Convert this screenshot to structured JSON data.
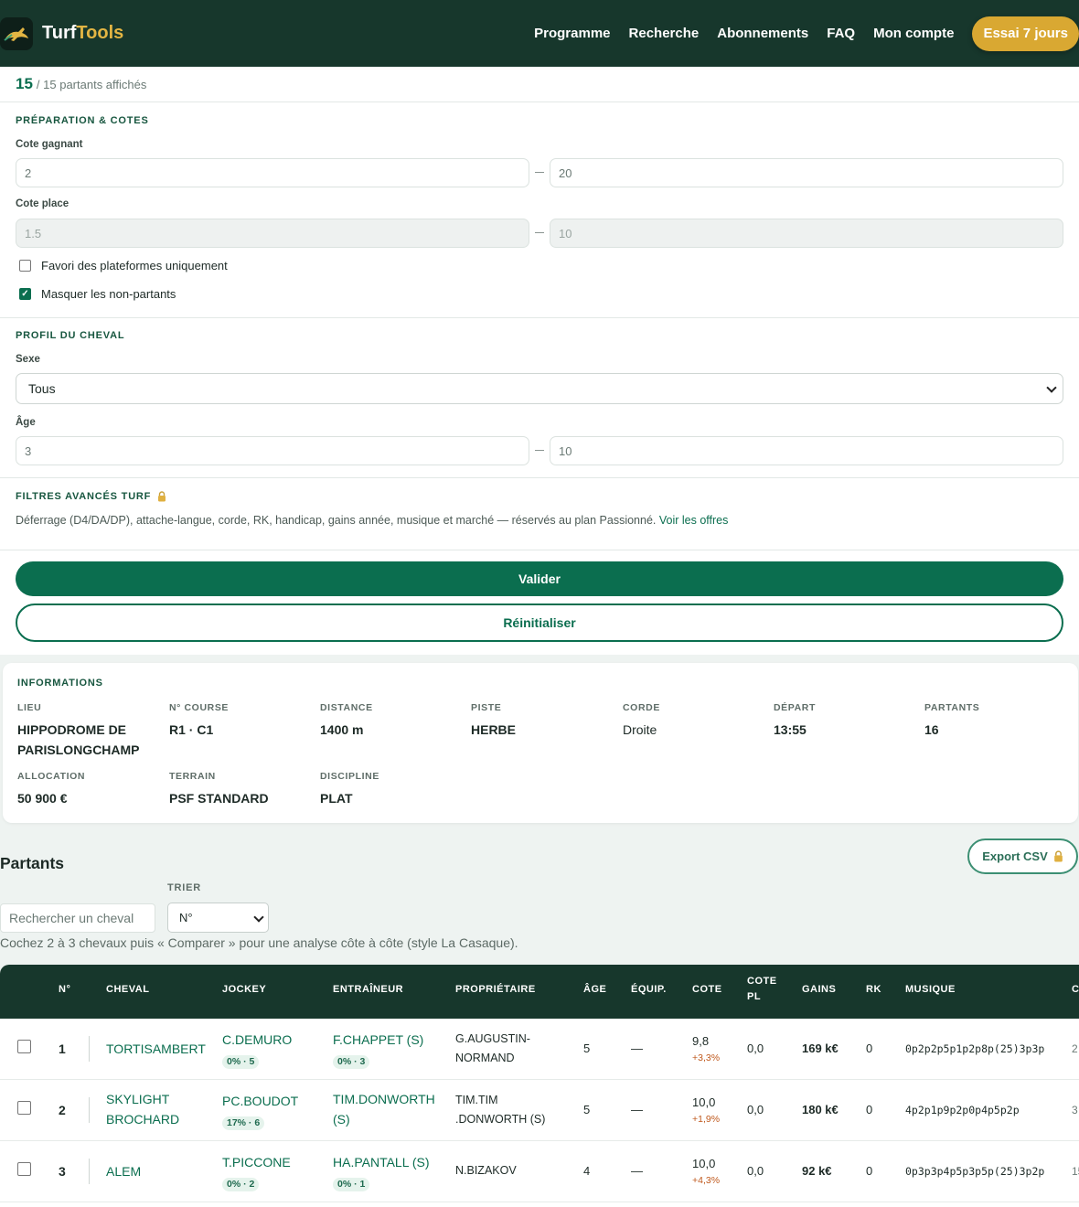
{
  "nav": {
    "brand_main": "Turf",
    "brand_accent": "Tools",
    "links": [
      "Programme",
      "Recherche",
      "Abonnements",
      "FAQ",
      "Mon compte"
    ],
    "cta": "Essai 7 jours"
  },
  "filters": {
    "count_shown": "15",
    "count_total": "/ 15 partants affichés",
    "prep_title": "PRÉPARATION & COTES",
    "cote_gagnant_label": "Cote gagnant",
    "cote_gagnant_min": "2",
    "cote_gagnant_max": "20",
    "cote_place_label": "Cote place",
    "cote_place_min": "1.5",
    "cote_place_max": "10",
    "favori_label": "Favori des plateformes uniquement",
    "masquer_label": "Masquer les non-partants",
    "profil_title": "PROFIL DU CHEVAL",
    "sexe_label": "Sexe",
    "sexe_value": "Tous",
    "age_label": "Âge",
    "age_min": "3",
    "age_max": "10",
    "advanced_title": "FILTRES AVANCÉS TURF",
    "advanced_text": "Déferrage (D4/DA/DP), attache-langue, corde, RK, handicap, gains année, musique et marché — réservés au plan Passionné.",
    "advanced_link": "Voir les offres",
    "valider": "Valider",
    "reinitialiser": "Réinitialiser"
  },
  "info": {
    "title": "INFORMATIONS",
    "items": [
      {
        "k": "LIEU",
        "v": "HIPPODROME DE PARISLONGCHAMP"
      },
      {
        "k": "N° COURSE",
        "v": "R1 · C1"
      },
      {
        "k": "DISTANCE",
        "v": "1400 m"
      },
      {
        "k": "PISTE",
        "v": "HERBE"
      },
      {
        "k": "CORDE",
        "v": "Droite"
      },
      {
        "k": "DÉPART",
        "v": "13:55"
      },
      {
        "k": "PARTANTS",
        "v": "16"
      },
      {
        "k": "ALLOCATION",
        "v": "50 900 €"
      },
      {
        "k": "TERRAIN",
        "v": "PSF STANDARD"
      },
      {
        "k": "DISCIPLINE",
        "v": "PLAT"
      }
    ]
  },
  "partants": {
    "title": "Partants",
    "export": "Export CSV",
    "trier_label": "TRIER",
    "search_placeholder": "Rechercher un cheval",
    "sort_value": "N°",
    "hint": "Cochez 2 à 3 chevaux puis « Comparer » pour une analyse côte à côte (style La Casaque)."
  },
  "table": {
    "headers": [
      "N°",
      "CHEVAL",
      "JOCKEY",
      "ENTRAÎNEUR",
      "PROPRIÉTAIRE",
      "ÂGE",
      "ÉQUIP.",
      "COTE",
      "COTE PL",
      "GAINS",
      "RK",
      "MUSIQUE",
      "C"
    ],
    "rows": [
      {
        "num": "1",
        "cheval": "TORTISAMBERT",
        "jockey": "C.DEMURO",
        "jockey_pct": "0% · 5",
        "entraineur": "F.CHAPPET (S)",
        "entraineur_pct": "0% · 3",
        "proprietaire": "G.AUGUSTIN-NORMAND",
        "age": "5",
        "equip": "—",
        "cote": "9,8",
        "cote_delta": "+3,3%",
        "cote_pl": "0,0",
        "gains": "169 k€",
        "rk": "0",
        "musique": "0p2p2p5p1p2p8p(25)3p3p",
        "c": "2"
      },
      {
        "num": "2",
        "cheval": "SKYLIGHT BROCHARD",
        "jockey": "PC.BOUDOT",
        "jockey_pct": "17% · 6",
        "entraineur": "TIM.DONWORTH (S)",
        "entraineur_pct": "",
        "proprietaire": "TIM.TIM .DONWORTH (S)",
        "age": "5",
        "equip": "—",
        "cote": "10,0",
        "cote_delta": "+1,9%",
        "cote_pl": "0,0",
        "gains": "180 k€",
        "rk": "0",
        "musique": "4p2p1p9p2p0p4p5p2p",
        "c": "3"
      },
      {
        "num": "3",
        "cheval": "ALEM",
        "jockey": "T.PICCONE",
        "jockey_pct": "0% · 2",
        "entraineur": "HA.PANTALL (S)",
        "entraineur_pct": "0% · 1",
        "proprietaire": "N.BIZAKOV",
        "age": "4",
        "equip": "—",
        "cote": "10,0",
        "cote_delta": "+4,3%",
        "cote_pl": "0,0",
        "gains": "92 k€",
        "rk": "0",
        "musique": "0p3p3p4p5p3p5p(25)3p2p",
        "c": "15"
      }
    ]
  }
}
